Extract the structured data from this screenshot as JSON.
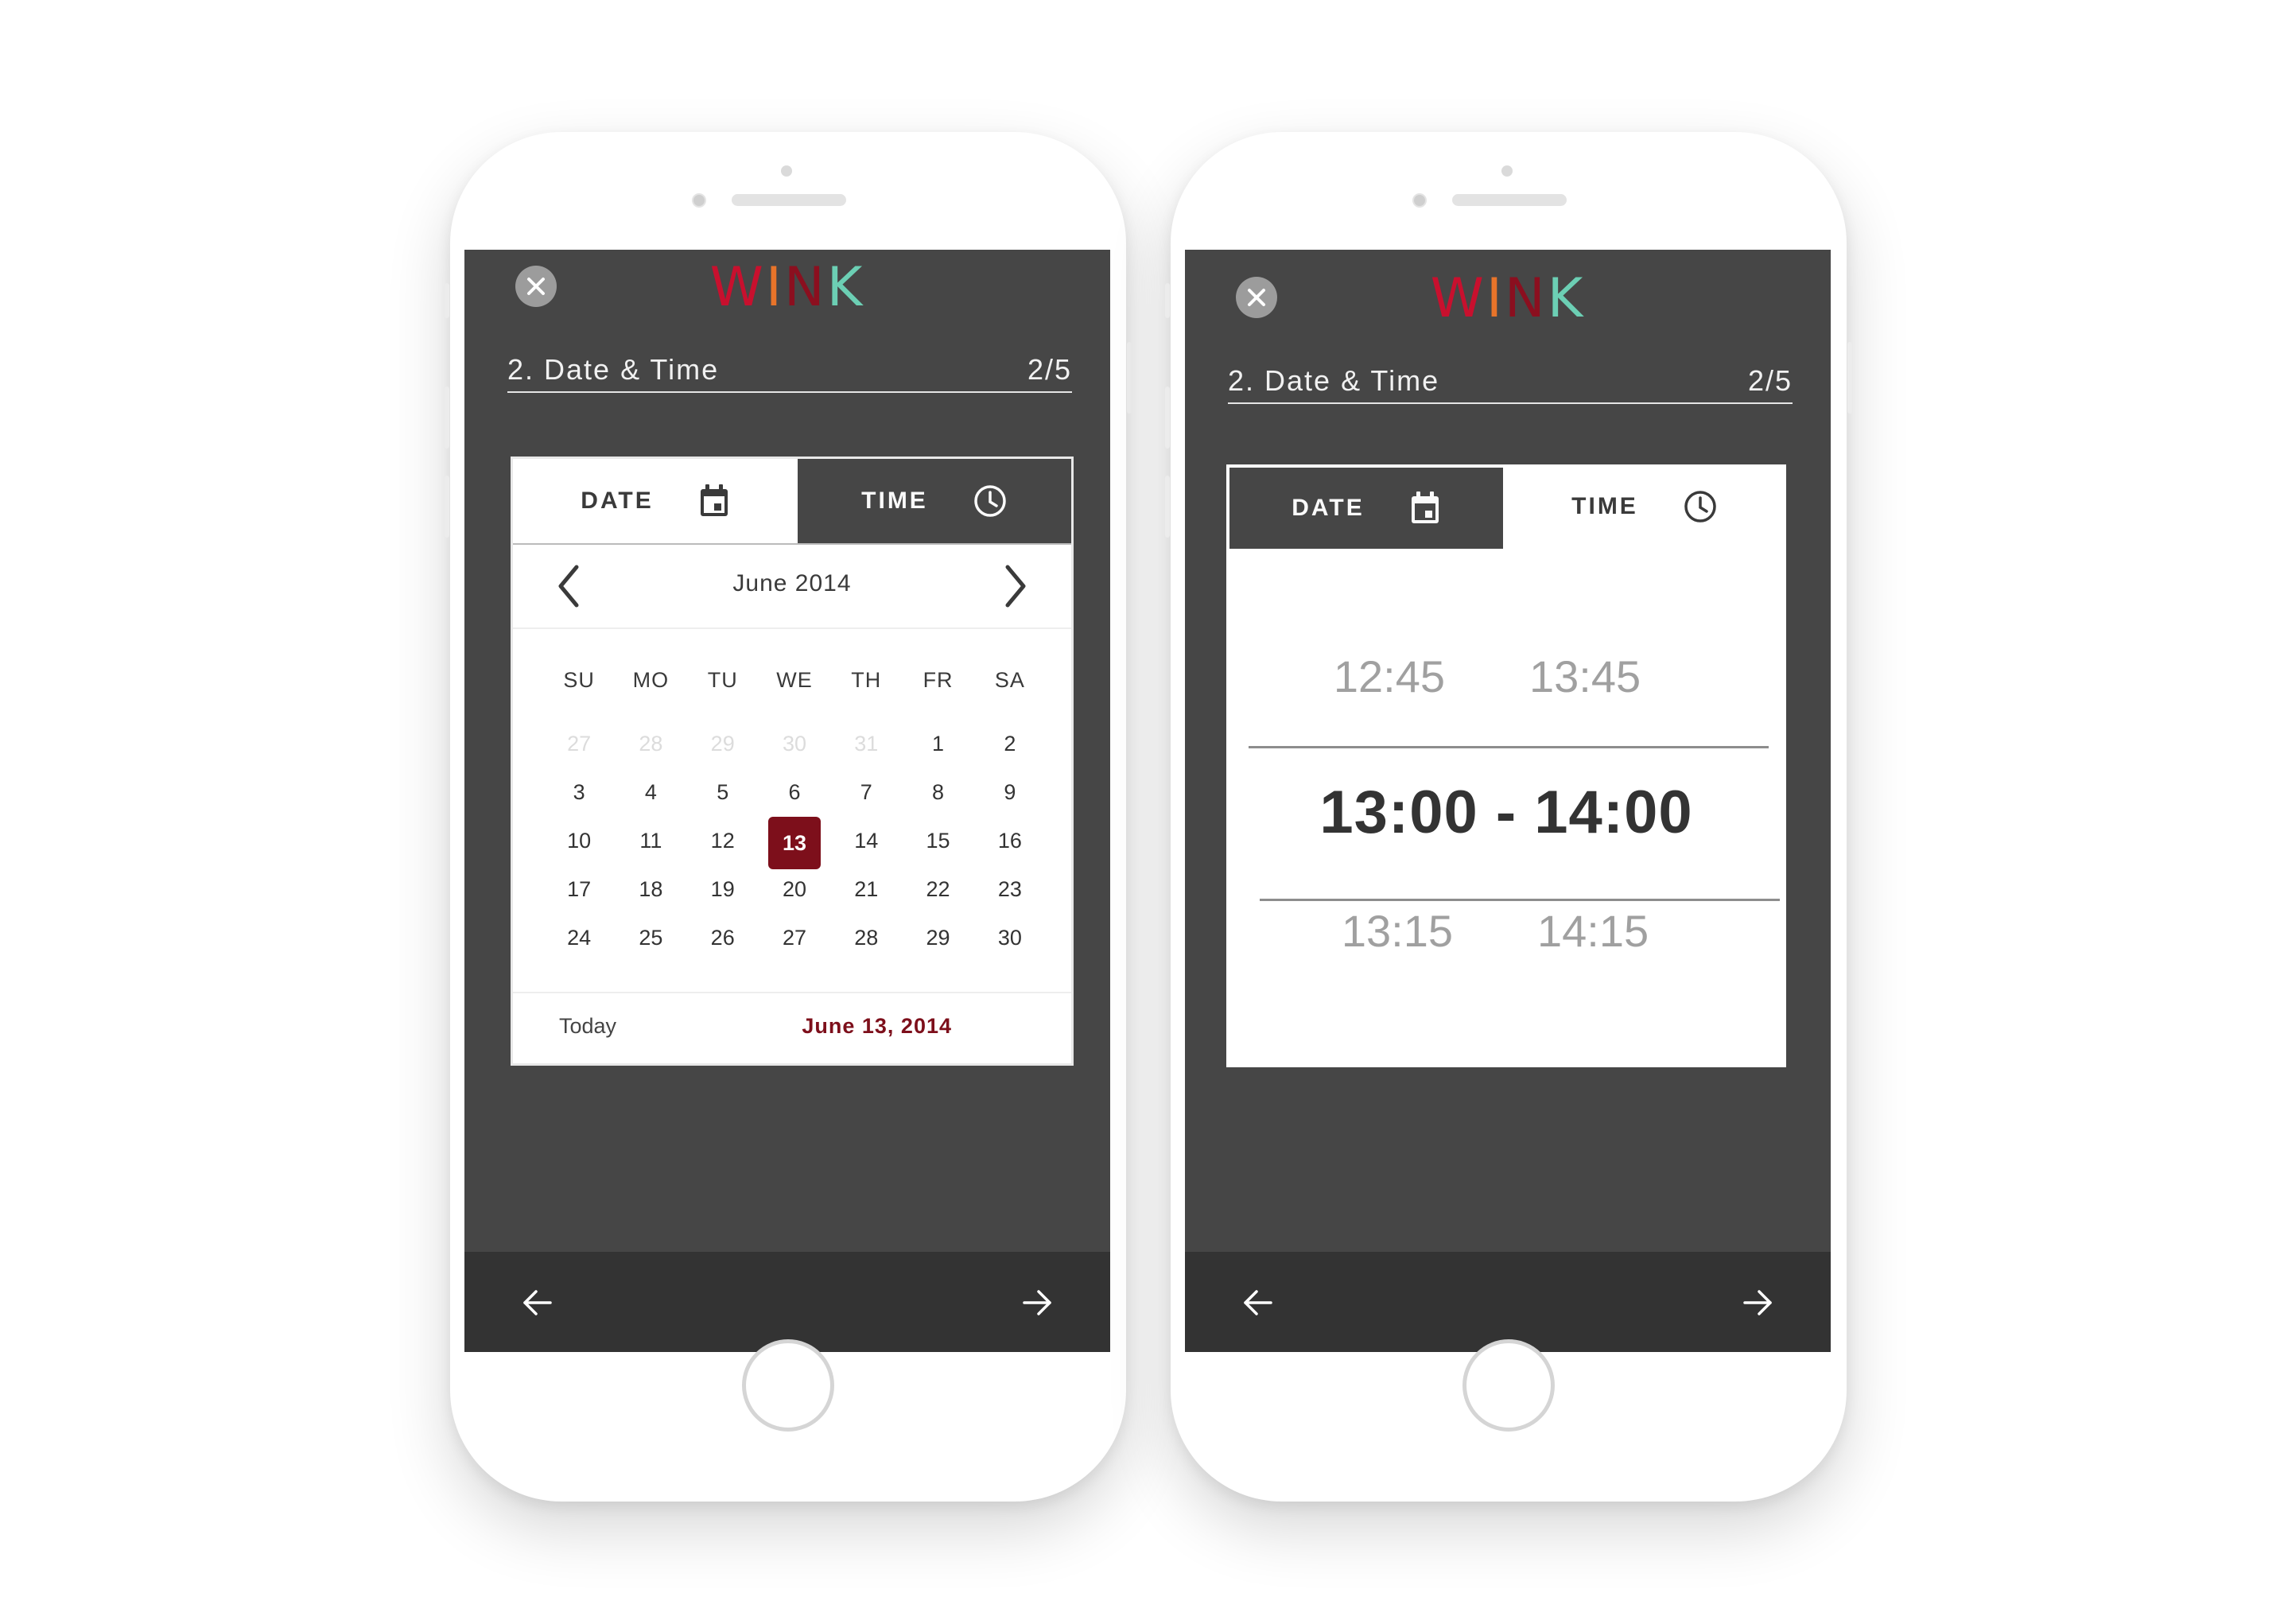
{
  "brand": {
    "letters": [
      {
        "char": "W",
        "color": "#c8102e"
      },
      {
        "char": "I",
        "color": "#e8742a"
      },
      {
        "char": "N",
        "color": "#8b0f1f"
      },
      {
        "char": "K",
        "color": "#6ccfb4"
      }
    ]
  },
  "colors": {
    "screen_bg": "#464646",
    "bottom_bar": "#333333",
    "accent": "#7d0f1b",
    "card_bg": "#ffffff"
  },
  "screens": {
    "left": {
      "step_title": "2. Date & Time",
      "step_count": "2/5",
      "tabs": {
        "date_label": "DATE",
        "time_label": "TIME",
        "active": "date"
      },
      "calendar": {
        "month_label": "June 2014",
        "weekdays": [
          "SU",
          "MO",
          "TU",
          "WE",
          "TH",
          "FR",
          "SA"
        ],
        "weeks": [
          [
            "27",
            "28",
            "29",
            "30",
            "31",
            "1",
            "2"
          ],
          [
            "3",
            "4",
            "5",
            "6",
            "7",
            "8",
            "9"
          ],
          [
            "10",
            "11",
            "12",
            "13",
            "14",
            "15",
            "16"
          ],
          [
            "17",
            "18",
            "19",
            "20",
            "21",
            "22",
            "23"
          ],
          [
            "24",
            "25",
            "26",
            "27",
            "28",
            "29",
            "30"
          ]
        ],
        "muted_days_in_first_week": 5,
        "selected_day": "13",
        "today_label": "Today",
        "selected_date_label": "June 13, 2014"
      }
    },
    "right": {
      "step_title": "2. Date & Time",
      "step_count": "2/5",
      "tabs": {
        "date_label": "DATE",
        "time_label": "TIME",
        "active": "time"
      },
      "time_picker": {
        "above": {
          "start": "12:45",
          "end": "13:45"
        },
        "selected": "13:00 - 14:00",
        "below": {
          "start": "13:15",
          "end": "14:15"
        }
      }
    }
  }
}
